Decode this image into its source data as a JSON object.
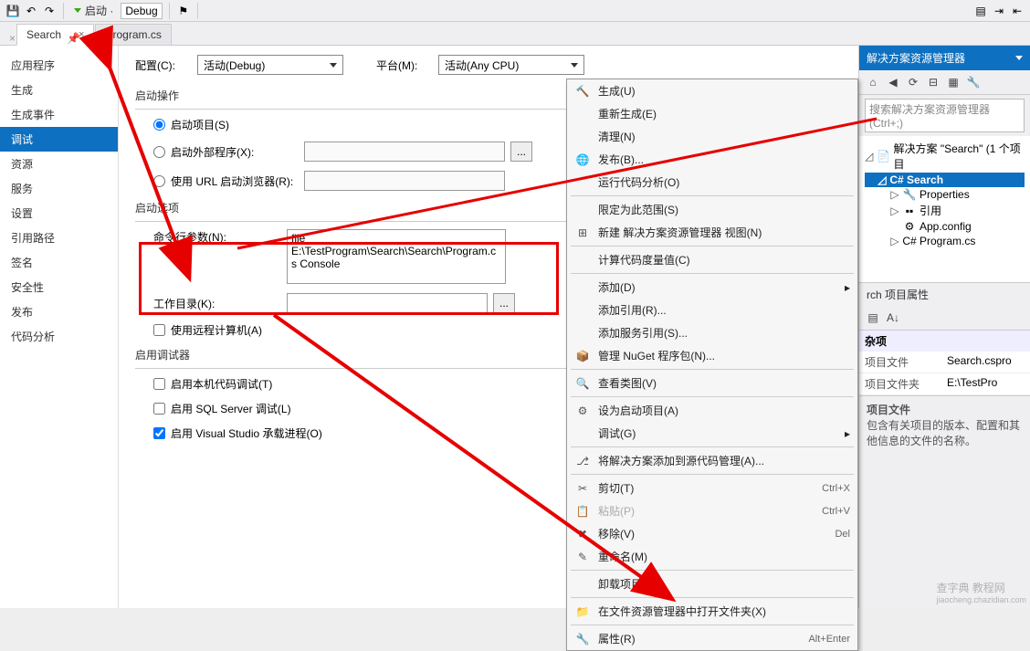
{
  "toolbar": {
    "start_label": "启动",
    "config_combo": "Debug"
  },
  "tabs": {
    "active": "Search",
    "second": "Program.cs"
  },
  "leftnav": {
    "items": [
      "应用程序",
      "生成",
      "生成事件",
      "调试",
      "资源",
      "服务",
      "设置",
      "引用路径",
      "签名",
      "安全性",
      "发布",
      "代码分析"
    ],
    "selected_index": 3
  },
  "debug_page": {
    "config_label": "配置(C):",
    "config_value": "活动(Debug)",
    "platform_label": "平台(M):",
    "platform_value": "活动(Any CPU)",
    "group_start": "启动操作",
    "radio_project": "启动项目(S)",
    "radio_external": "启动外部程序(X):",
    "radio_url": "使用 URL 启动浏览器(R):",
    "group_options": "启动选项",
    "cmdline_label": "命令行参数(N):",
    "cmdline_value": "file E:\\TestProgram\\Search\\Search\\Program.cs Console",
    "workdir_label": "工作目录(K):",
    "remote_label": "使用远程计算机(A)",
    "group_debugger": "启用调试器",
    "chk_native": "启用本机代码调试(T)",
    "chk_sql": "启用 SQL Server 调试(L)",
    "chk_host": "启用 Visual Studio 承载进程(O)"
  },
  "ctx": [
    {
      "ic": "build",
      "lbl": "生成(U)"
    },
    {
      "ic": "",
      "lbl": "重新生成(E)"
    },
    {
      "ic": "",
      "lbl": "清理(N)"
    },
    {
      "ic": "publish",
      "lbl": "发布(B)..."
    },
    {
      "ic": "",
      "lbl": "运行代码分析(O)"
    },
    {
      "sep": true
    },
    {
      "ic": "",
      "lbl": "限定为此范围(S)"
    },
    {
      "ic": "newse",
      "lbl": "新建 解决方案资源管理器 视图(N)"
    },
    {
      "sep": true
    },
    {
      "ic": "",
      "lbl": "计算代码度量值(C)"
    },
    {
      "sep": true
    },
    {
      "ic": "",
      "lbl": "添加(D)",
      "sub": true
    },
    {
      "ic": "",
      "lbl": "添加引用(R)..."
    },
    {
      "ic": "",
      "lbl": "添加服务引用(S)..."
    },
    {
      "ic": "nuget",
      "lbl": "管理 NuGet 程序包(N)..."
    },
    {
      "sep": true
    },
    {
      "ic": "class",
      "lbl": "查看类图(V)"
    },
    {
      "sep": true
    },
    {
      "ic": "startup",
      "lbl": "设为启动项目(A)"
    },
    {
      "ic": "",
      "lbl": "调试(G)",
      "sub": true
    },
    {
      "sep": true
    },
    {
      "ic": "src",
      "lbl": "将解决方案添加到源代码管理(A)..."
    },
    {
      "sep": true
    },
    {
      "ic": "cut",
      "lbl": "剪切(T)",
      "sc": "Ctrl+X"
    },
    {
      "ic": "paste",
      "lbl": "粘贴(P)",
      "sc": "Ctrl+V",
      "dis": true
    },
    {
      "ic": "del",
      "lbl": "移除(V)",
      "sc": "Del"
    },
    {
      "ic": "rename",
      "lbl": "重命名(M)"
    },
    {
      "sep": true
    },
    {
      "ic": "",
      "lbl": "卸载项目(L)"
    },
    {
      "sep": true
    },
    {
      "ic": "folder",
      "lbl": "在文件资源管理器中打开文件夹(X)"
    },
    {
      "sep": true
    },
    {
      "ic": "prop",
      "lbl": "属性(R)",
      "sc": "Alt+Enter"
    }
  ],
  "solution": {
    "panel_title": "解决方案资源管理器",
    "search_ph": "搜索解决方案资源管理器(Ctrl+;)",
    "root": "解决方案 \"Search\" (1 个项目",
    "project": "Search",
    "nodes": [
      "Properties",
      "引用",
      "App.config",
      "Program.cs"
    ]
  },
  "props": {
    "header_suffix": "rch 项目属性",
    "cat": "杂项",
    "rows": [
      {
        "k": "项目文件",
        "v": "Search.cspro"
      },
      {
        "k": "项目文件夹",
        "v": "E:\\TestPro"
      }
    ],
    "desc_title": "项目文件",
    "desc_body": "包含有关项目的版本、配置和其他信息的文件的名称。"
  },
  "watermark": {
    "line1": "查字典  教程网",
    "line2": "jiaocheng.chazidian.com"
  }
}
